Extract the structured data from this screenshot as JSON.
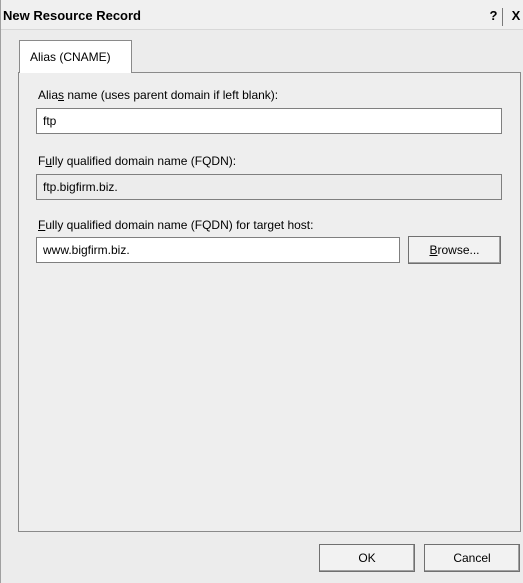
{
  "window": {
    "title": "New Resource Record"
  },
  "titlebar": {
    "help_label": "?",
    "close_label": "X"
  },
  "tabs": [
    {
      "label": "Alias (CNAME)"
    }
  ],
  "alias": {
    "label_pre": "Alia",
    "label_accel": "s",
    "label_post": " name (uses parent domain if left blank):",
    "value": "ftp"
  },
  "fqdn": {
    "label_pre": "F",
    "label_accel": "u",
    "label_post": "lly qualified domain name (FQDN):",
    "value": "ftp.bigfirm.biz."
  },
  "target": {
    "label_accel": "F",
    "label_post": "ully qualified domain name (FQDN) for target host:",
    "value": "www.bigfirm.biz.",
    "browse_accel": "B",
    "browse_post": "rowse..."
  },
  "footer": {
    "ok_label": "OK",
    "cancel_label": "Cancel"
  }
}
